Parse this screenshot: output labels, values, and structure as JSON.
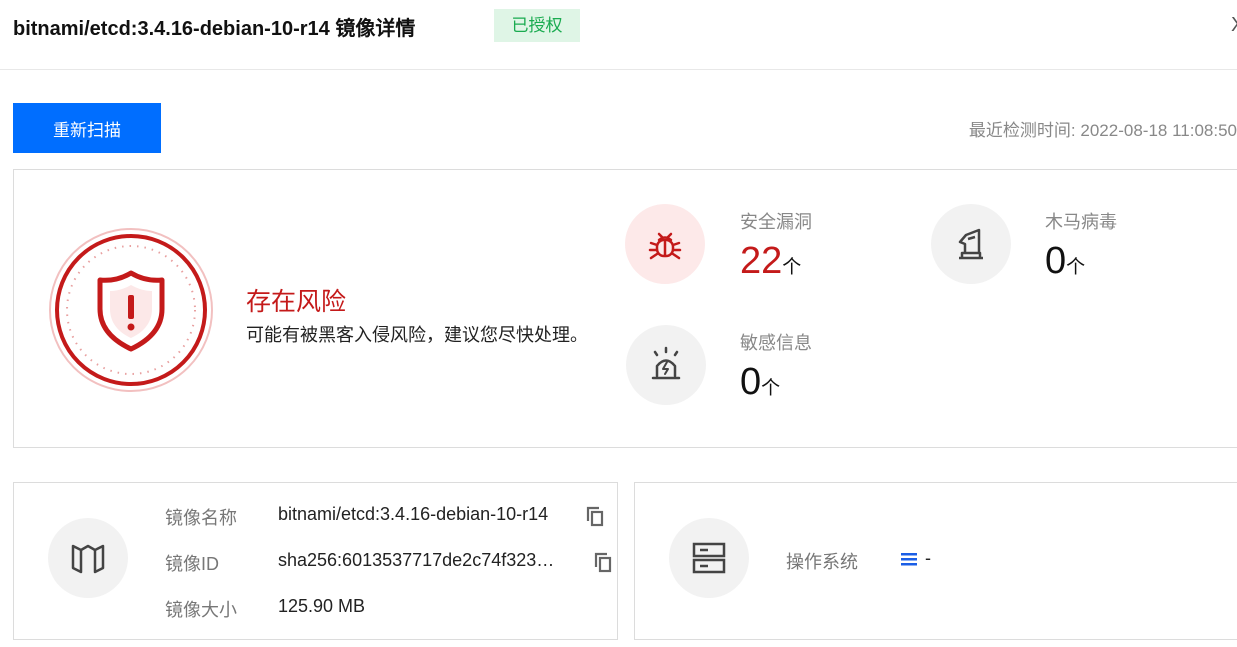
{
  "header": {
    "title": "bitnami/etcd:3.4.16-debian-10-r14 镜像详情",
    "badge": "已授权",
    "close_glyph": "X"
  },
  "toolbar": {
    "rescan_label": "重新扫描",
    "scan_time_label": "最近检测时间:",
    "scan_time_value": "2022-08-18 11:08:50"
  },
  "risk": {
    "title": "存在风险",
    "description": "可能有被黑客入侵风险，建议您尽快处理。",
    "icon": "shield-alert-icon"
  },
  "stats": [
    {
      "label": "安全漏洞",
      "value": "22",
      "unit": "个",
      "icon": "bug-icon",
      "highlight": true
    },
    {
      "label": "木马病毒",
      "value": "0",
      "unit": "个",
      "icon": "trojan-icon",
      "highlight": false
    },
    {
      "label": "敏感信息",
      "value": "0",
      "unit": "个",
      "icon": "alarm-icon",
      "highlight": false
    }
  ],
  "image_info": {
    "icon": "image-book-icon",
    "rows": [
      {
        "label": "镜像名称",
        "value": "bitnami/etcd:3.4.16-debian-10-r14"
      },
      {
        "label": "镜像ID",
        "value": "sha256:6013537717de2c74f323…"
      },
      {
        "label": "镜像大小",
        "value": "125.90 MB"
      }
    ]
  },
  "os_info": {
    "icon": "server-icon",
    "label": "操作系统",
    "value": "-",
    "value_icon": "list-icon"
  },
  "colors": {
    "primary": "#006eff",
    "danger": "#c41a1a",
    "success": "#1aab50",
    "success_bg": "#dff5e6"
  }
}
